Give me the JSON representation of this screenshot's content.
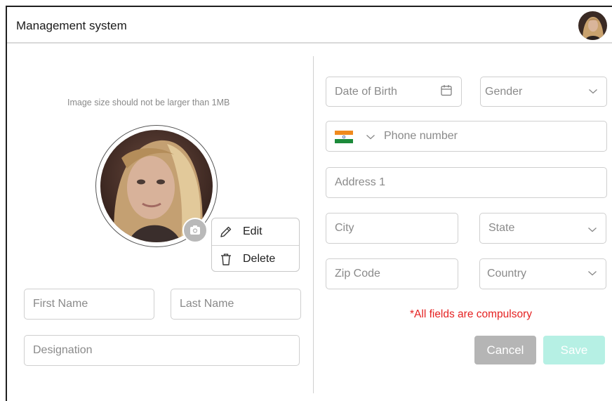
{
  "header": {
    "title": "Management system"
  },
  "upload": {
    "hint": "Image size should not be larger than 1MB"
  },
  "photo_menu": {
    "edit_label": "Edit",
    "delete_label": "Delete"
  },
  "form": {
    "first_name_placeholder": "First Name",
    "last_name_placeholder": "Last Name",
    "designation_placeholder": "Designation",
    "dob_placeholder": "Date of Birth",
    "gender_placeholder": "Gender",
    "phone_placeholder": "Phone number",
    "address1_placeholder": "Address 1",
    "city_placeholder": "City",
    "state_placeholder": "State",
    "zip_placeholder": "Zip Code",
    "country_placeholder": "Country",
    "required_note": "*All fields are compulsory"
  },
  "actions": {
    "cancel_label": "Cancel",
    "save_label": "Save"
  },
  "colors": {
    "required_red": "#e52222",
    "cancel_gray": "#b5b5b5",
    "save_mint": "#b6f0e4"
  },
  "icons": {
    "calendar": "calendar-icon",
    "chevron": "chevron-down-icon",
    "camera": "camera-icon",
    "pencil": "pencil-icon",
    "trash": "trash-icon",
    "flag": "india-flag-icon"
  }
}
